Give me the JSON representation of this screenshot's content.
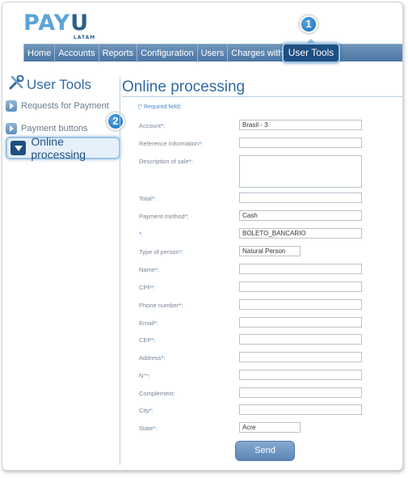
{
  "logo": {
    "main_light": "PAY",
    "main_dark": "U",
    "sub": "LATAM"
  },
  "topnav": {
    "items": [
      "Home",
      "Accounts",
      "Reports",
      "Configuration",
      "Users",
      "Charges with token"
    ],
    "active": "User Tools"
  },
  "callouts": {
    "first": "1",
    "second": "2"
  },
  "sidebar": {
    "title": "User Tools",
    "items": [
      {
        "label": "Requests for Payment"
      },
      {
        "label": "Payment buttons"
      }
    ],
    "active_label": "Online processing"
  },
  "main": {
    "title": "Online processing",
    "required_note": "(* Required field)",
    "fields": [
      {
        "label": "Account",
        "required": "*:",
        "value": "Brasil - 3"
      },
      {
        "label": "Reference Information",
        "required": "*:",
        "value": ""
      },
      {
        "label": "Description of sale",
        "required": "*:",
        "value": ""
      },
      {
        "label": "Total",
        "required": "*:",
        "value": ""
      },
      {
        "label": "Payment method",
        "required": "*:",
        "value": "Cash"
      },
      {
        "label": "",
        "required": "*:",
        "value": "BOLETO_BANCARIO"
      },
      {
        "label": "Type of person",
        "required": "*:",
        "value": "Natural Person"
      },
      {
        "label": "Name",
        "required": "*:",
        "value": ""
      },
      {
        "label": "CPF",
        "required": "*:",
        "value": ""
      },
      {
        "label": "Phone number",
        "required": "*:",
        "value": ""
      },
      {
        "label": "Email",
        "required": "*:",
        "value": ""
      },
      {
        "label": "CEP",
        "required": "*:",
        "value": ""
      },
      {
        "label": "Address",
        "required": "*:",
        "value": ""
      },
      {
        "label": "N°",
        "required": "*:",
        "value": ""
      },
      {
        "label": "Complement:",
        "required": "",
        "value": ""
      },
      {
        "label": "City",
        "required": "*:",
        "value": ""
      },
      {
        "label": "State",
        "required": "*:",
        "value": "Acre"
      }
    ],
    "send_label": "Send"
  },
  "colors": {
    "accent": "#2e6aa5",
    "nav": "#4a76a4",
    "active": "#1f4e82"
  }
}
